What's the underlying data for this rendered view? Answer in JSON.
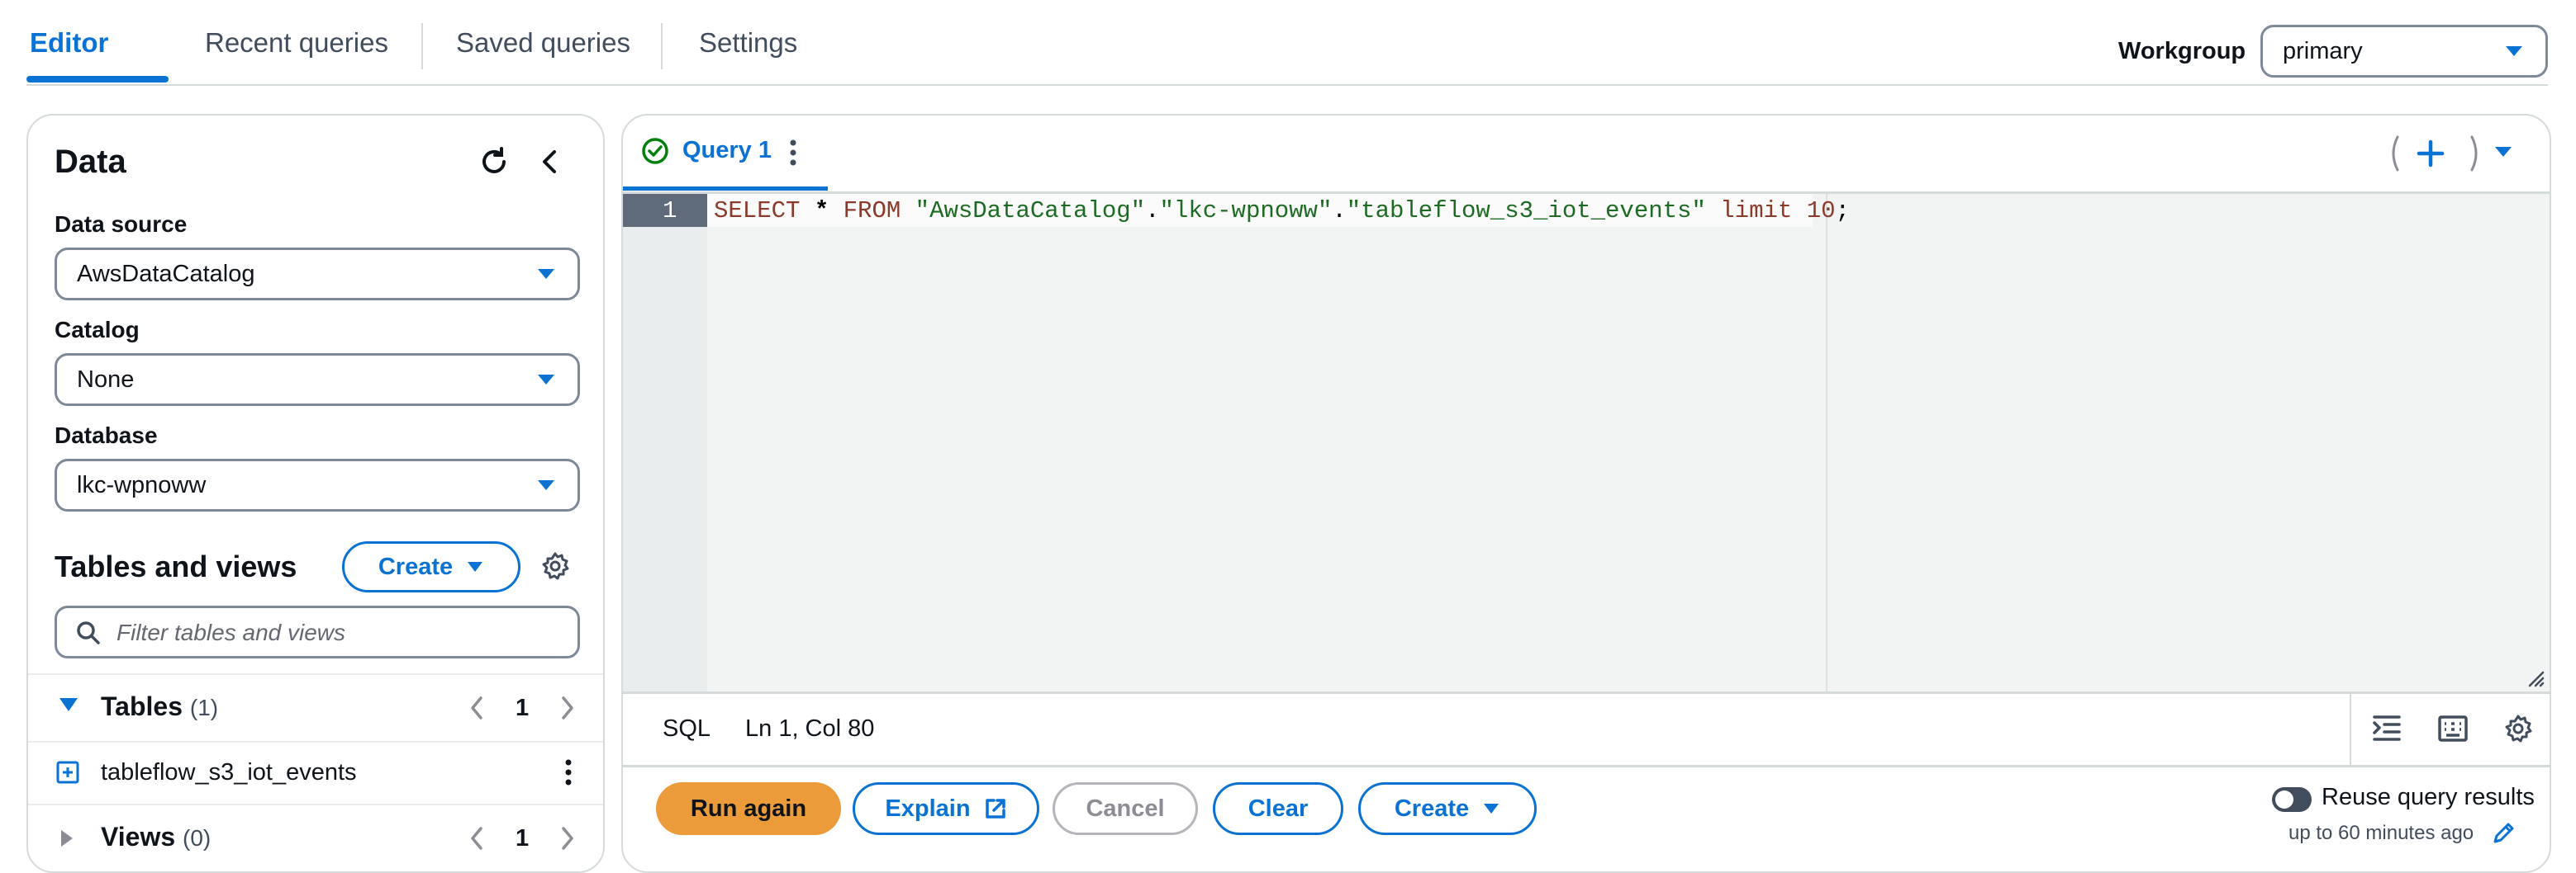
{
  "tabs": [
    {
      "label": "Editor",
      "active": true
    },
    {
      "label": "Recent queries",
      "active": false
    },
    {
      "label": "Saved queries",
      "active": false
    },
    {
      "label": "Settings",
      "active": false
    }
  ],
  "workgroup": {
    "label": "Workgroup",
    "value": "primary"
  },
  "data_panel": {
    "title": "Data",
    "data_source": {
      "label": "Data source",
      "value": "AwsDataCatalog"
    },
    "catalog": {
      "label": "Catalog",
      "value": "None"
    },
    "database": {
      "label": "Database",
      "value": "lkc-wpnoww"
    },
    "tables_views": {
      "title": "Tables and views",
      "create_label": "Create",
      "filter_placeholder": "Filter tables and views"
    },
    "tables": {
      "label": "Tables",
      "count": "(1)",
      "page": "1"
    },
    "table_items": [
      "tableflow_s3_iot_events"
    ],
    "views": {
      "label": "Views",
      "count": "(0)",
      "page": "1"
    }
  },
  "editor": {
    "query_tab": "Query 1",
    "line_number": "1",
    "code_tokens": [
      {
        "t": "SELECT",
        "c": "kw"
      },
      {
        "t": " ",
        "c": "pun"
      },
      {
        "t": "*",
        "c": "op"
      },
      {
        "t": " ",
        "c": "pun"
      },
      {
        "t": "FROM",
        "c": "kw"
      },
      {
        "t": " ",
        "c": "pun"
      },
      {
        "t": "\"AwsDataCatalog\"",
        "c": "str"
      },
      {
        "t": ".",
        "c": "pun"
      },
      {
        "t": "\"lkc-wpnoww\"",
        "c": "str"
      },
      {
        "t": ".",
        "c": "pun"
      },
      {
        "t": "\"tableflow_s3_iot_events\"",
        "c": "str"
      },
      {
        "t": " ",
        "c": "pun"
      },
      {
        "t": "limit",
        "c": "kw"
      },
      {
        "t": " ",
        "c": "pun"
      },
      {
        "t": "10",
        "c": "num"
      },
      {
        "t": ";",
        "c": "pun"
      }
    ],
    "language": "SQL",
    "cursor": "Ln 1, Col 80"
  },
  "actions": {
    "run": "Run again",
    "explain": "Explain",
    "cancel": "Cancel",
    "clear": "Clear",
    "create": "Create",
    "reuse_label": "Reuse query results",
    "reuse_sub": "up to 60 minutes ago"
  },
  "colors": {
    "accent": "#0972d3",
    "run_button": "#ec9b3a",
    "success": "#037f0c"
  }
}
